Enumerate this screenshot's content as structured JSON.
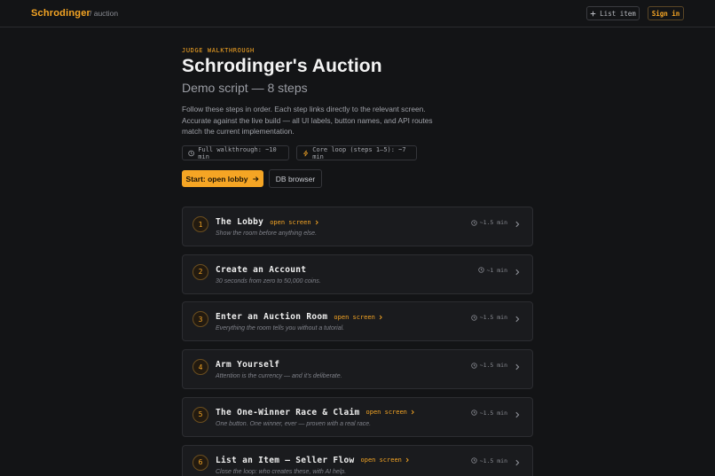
{
  "header": {
    "brand": "Schrodinger",
    "crumb": "/ auction",
    "list_item_label": "List item",
    "sign_in_label": "Sign in"
  },
  "hero": {
    "eyebrow": "JUDGE WALKTHROUGH",
    "title": "Schrodinger's Auction",
    "subtitle": "Demo script — 8 steps",
    "intro": "Follow these steps in order. Each step links directly to the relevant screen. Accurate against the live build — all UI labels, button names, and API routes match the current implementation.",
    "chip_full": "Full walkthrough: ~10 min",
    "chip_core": "Core loop (steps 1–5): ~7 min",
    "start_label": "Start: open lobby",
    "db_label": "DB browser"
  },
  "steps": [
    {
      "num": "1",
      "title": "The Lobby",
      "link": "open screen",
      "desc": "Show the room before anything else.",
      "duration": "~1.5 min"
    },
    {
      "num": "2",
      "title": "Create an Account",
      "link": "",
      "desc": "30 seconds from zero to 50,000 coins.",
      "duration": "~1 min"
    },
    {
      "num": "3",
      "title": "Enter an Auction Room",
      "link": "open screen",
      "desc": "Everything the room tells you without a tutorial.",
      "duration": "~1.5 min"
    },
    {
      "num": "4",
      "title": "Arm Yourself",
      "link": "",
      "desc": "Attention is the currency — and it's deliberate.",
      "duration": "~1.5 min"
    },
    {
      "num": "5",
      "title": "The One-Winner Race & Claim",
      "link": "open screen",
      "desc": "One button. One winner, ever — proven with a real race.",
      "duration": "~1.5 min"
    },
    {
      "num": "6",
      "title": "List an Item — Seller Flow",
      "link": "open screen",
      "desc": "Close the loop: who creates these, with AI help.",
      "duration": "~1.5 min"
    }
  ],
  "colors": {
    "accent": "#f5a524",
    "background": "#131416",
    "card": "#1a1b1e"
  },
  "icons": {
    "list_item": "plus-icon",
    "chip_full": "clock-icon",
    "chip_core": "lightning-icon",
    "start": "arrow-right-icon",
    "duration": "clock-icon",
    "row": "chevron-right-icon"
  }
}
